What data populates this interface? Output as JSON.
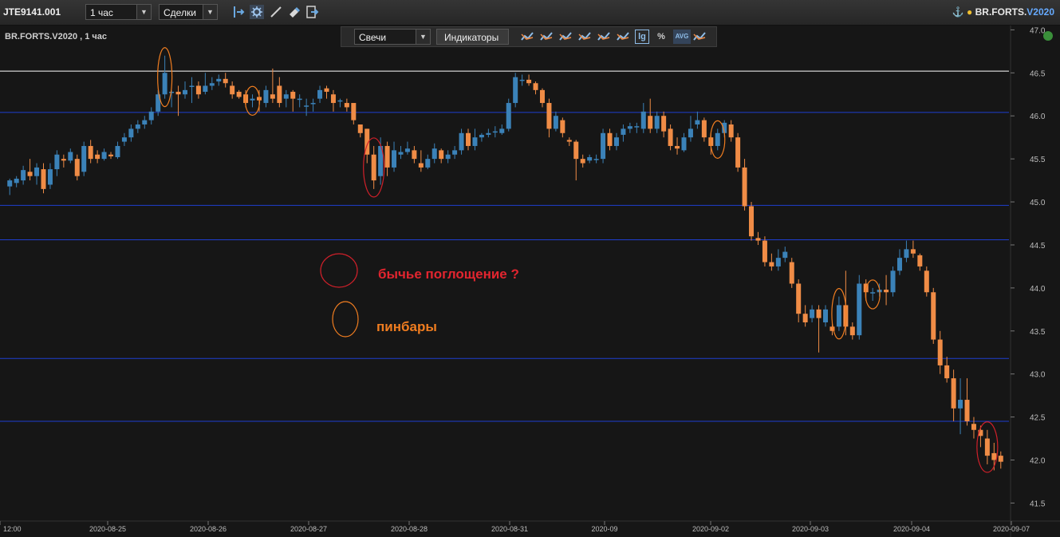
{
  "toolbar": {
    "account": "JTE9141.001",
    "interval": "1 час",
    "trades": "Сделки",
    "symbol": "BR.FORTS.",
    "symbol_version": "V2020",
    "icons": [
      "cursor-icon",
      "settings-icon",
      "draw-line-icon",
      "eraser-icon",
      "export-icon"
    ]
  },
  "chart": {
    "title": "BR.FORTS.V2020 , 1 час",
    "chart_type_select": "Свечи",
    "indicators_button": "Индикаторы",
    "percent_icon_label": "%",
    "lg_icon_label": "lg",
    "avg_icon_label": "AVG",
    "annotation_engulfing": "бычье поглощение ?",
    "annotation_pinbars": "пинбары",
    "colors": {
      "up": "#3b82b8",
      "down": "#f08c46",
      "level_line": "#1f3fd0",
      "white_line": "#ffffff",
      "engulf_mark": "#d0202a",
      "pinbar_mark": "#f07d20"
    }
  },
  "chart_data": {
    "type": "candlestick",
    "y_ticks": [
      "47.0",
      "46.5",
      "46.0",
      "45.5",
      "45.0",
      "44.5",
      "44.0",
      "43.5",
      "43.0",
      "42.5",
      "42.0",
      "41.5"
    ],
    "ylim": [
      41.3,
      47.05
    ],
    "x_ticks": [
      "12:00",
      "2020-08-25",
      "2020-08-26",
      "2020-08-27",
      "2020-08-28",
      "2020-08-31",
      "2020-09",
      "2020-09-02",
      "2020-09-03",
      "2020-09-04",
      "2020-09-07"
    ],
    "horizontal_levels": [
      46.52,
      46.04,
      44.96,
      44.56,
      43.18,
      42.45
    ],
    "candles": [
      [
        45.18,
        45.25,
        45.08,
        45.27
      ],
      [
        45.22,
        45.27,
        45.17,
        45.3
      ],
      [
        45.25,
        45.37,
        45.2,
        45.42
      ],
      [
        45.35,
        45.3,
        45.25,
        45.5
      ],
      [
        45.3,
        45.4,
        45.2,
        45.45
      ],
      [
        45.38,
        45.15,
        45.1,
        45.45
      ],
      [
        45.2,
        45.38,
        45.15,
        45.45
      ],
      [
        45.38,
        45.55,
        45.3,
        45.6
      ],
      [
        45.5,
        45.48,
        45.4,
        45.55
      ],
      [
        45.48,
        45.58,
        45.45,
        45.62
      ],
      [
        45.5,
        45.3,
        45.25,
        45.55
      ],
      [
        45.35,
        45.65,
        45.3,
        45.7
      ],
      [
        45.65,
        45.5,
        45.45,
        45.72
      ],
      [
        45.55,
        45.5,
        45.45,
        45.6
      ],
      [
        45.5,
        45.58,
        45.48,
        45.62
      ],
      [
        45.55,
        45.53,
        45.5,
        45.58
      ],
      [
        45.52,
        45.65,
        45.5,
        45.7
      ],
      [
        45.7,
        45.75,
        45.65,
        45.8
      ],
      [
        45.75,
        45.85,
        45.7,
        45.9
      ],
      [
        45.85,
        45.9,
        45.8,
        45.95
      ],
      [
        45.9,
        45.95,
        45.85,
        46.0
      ],
      [
        45.95,
        46.05,
        45.9,
        46.1
      ],
      [
        46.05,
        46.25,
        46.0,
        46.3
      ],
      [
        46.25,
        46.5,
        46.2,
        46.7
      ],
      [
        46.28,
        46.28,
        46.1,
        46.3
      ],
      [
        46.28,
        46.25,
        46.0,
        46.35
      ],
      [
        46.25,
        46.3,
        46.2,
        46.4
      ],
      [
        46.35,
        46.35,
        46.15,
        46.45
      ],
      [
        46.35,
        46.25,
        46.2,
        46.4
      ],
      [
        46.28,
        46.35,
        46.25,
        46.5
      ],
      [
        46.35,
        46.38,
        46.3,
        46.45
      ],
      [
        46.4,
        46.43,
        46.35,
        46.48
      ],
      [
        46.43,
        46.38,
        46.33,
        46.5
      ],
      [
        46.35,
        46.25,
        46.2,
        46.4
      ],
      [
        46.28,
        46.22,
        46.2,
        46.3
      ],
      [
        46.25,
        46.15,
        46.1,
        46.3
      ],
      [
        46.18,
        46.2,
        46.1,
        46.25
      ],
      [
        46.22,
        46.18,
        46.05,
        46.3
      ],
      [
        46.15,
        46.3,
        46.1,
        46.35
      ],
      [
        46.25,
        46.2,
        46.15,
        46.55
      ],
      [
        46.35,
        46.15,
        46.1,
        46.45
      ],
      [
        46.2,
        46.25,
        46.1,
        46.3
      ],
      [
        46.28,
        46.2,
        46.05,
        46.3
      ],
      [
        46.2,
        46.2,
        46.1,
        46.25
      ],
      [
        46.12,
        46.12,
        46.0,
        46.2
      ],
      [
        46.15,
        46.15,
        46.05,
        46.2
      ],
      [
        46.2,
        46.3,
        46.15,
        46.35
      ],
      [
        46.32,
        46.28,
        46.2,
        46.35
      ],
      [
        46.25,
        46.15,
        46.05,
        46.3
      ],
      [
        46.18,
        46.18,
        46.1,
        46.2
      ],
      [
        46.15,
        46.1,
        46.05,
        46.2
      ],
      [
        46.15,
        45.95,
        45.9,
        46.1
      ],
      [
        45.9,
        45.8,
        45.75,
        45.9
      ],
      [
        45.85,
        45.55,
        45.45,
        45.85
      ],
      [
        45.55,
        45.25,
        45.15,
        45.65
      ],
      [
        45.3,
        45.65,
        45.2,
        45.75
      ],
      [
        45.65,
        45.4,
        45.3,
        45.7
      ],
      [
        45.4,
        45.6,
        45.35,
        45.7
      ],
      [
        45.55,
        45.58,
        45.5,
        45.65
      ],
      [
        45.58,
        45.62,
        45.55,
        45.7
      ],
      [
        45.6,
        45.5,
        45.45,
        45.65
      ],
      [
        45.45,
        45.4,
        45.35,
        45.6
      ],
      [
        45.4,
        45.5,
        45.38,
        45.55
      ],
      [
        45.5,
        45.62,
        45.45,
        45.68
      ],
      [
        45.6,
        45.5,
        45.45,
        45.62
      ],
      [
        45.5,
        45.55,
        45.45,
        45.6
      ],
      [
        45.55,
        45.6,
        45.5,
        45.65
      ],
      [
        45.6,
        45.8,
        45.55,
        45.85
      ],
      [
        45.8,
        45.65,
        45.6,
        45.85
      ],
      [
        45.65,
        45.75,
        45.6,
        45.85
      ],
      [
        45.75,
        45.78,
        45.7,
        45.8
      ],
      [
        45.78,
        45.8,
        45.75,
        45.85
      ],
      [
        45.82,
        45.82,
        45.75,
        45.88
      ],
      [
        45.8,
        45.85,
        45.78,
        45.9
      ],
      [
        45.85,
        46.15,
        45.82,
        46.2
      ],
      [
        46.15,
        46.45,
        46.1,
        46.5
      ],
      [
        46.42,
        46.42,
        46.35,
        46.48
      ],
      [
        46.42,
        46.38,
        46.35,
        46.48
      ],
      [
        46.38,
        46.3,
        46.25,
        46.4
      ],
      [
        46.3,
        46.15,
        46.1,
        46.32
      ],
      [
        46.15,
        45.85,
        45.75,
        46.2
      ],
      [
        45.85,
        46.0,
        45.82,
        46.05
      ],
      [
        45.95,
        45.8,
        45.75,
        45.98
      ],
      [
        45.72,
        45.7,
        45.65,
        45.75
      ],
      [
        45.7,
        45.5,
        45.25,
        45.72
      ],
      [
        45.5,
        45.45,
        45.4,
        45.55
      ],
      [
        45.48,
        45.52,
        45.45,
        45.55
      ],
      [
        45.5,
        45.5,
        45.45,
        45.55
      ],
      [
        45.5,
        45.8,
        45.45,
        45.85
      ],
      [
        45.8,
        45.65,
        45.6,
        45.85
      ],
      [
        45.65,
        45.75,
        45.6,
        45.8
      ],
      [
        45.78,
        45.85,
        45.7,
        45.9
      ],
      [
        45.85,
        45.88,
        45.8,
        45.92
      ],
      [
        45.88,
        45.88,
        45.8,
        45.92
      ],
      [
        45.85,
        46.05,
        45.8,
        46.15
      ],
      [
        46.0,
        45.85,
        45.8,
        46.2
      ],
      [
        45.85,
        46.0,
        45.8,
        46.05
      ],
      [
        46.0,
        45.82,
        45.75,
        46.05
      ],
      [
        45.85,
        45.65,
        45.6,
        45.9
      ],
      [
        45.65,
        45.62,
        45.55,
        45.75
      ],
      [
        45.6,
        45.75,
        45.58,
        45.8
      ],
      [
        45.75,
        45.85,
        45.7,
        46.0
      ],
      [
        45.9,
        45.95,
        45.85,
        46.05
      ],
      [
        45.95,
        45.75,
        45.7,
        45.98
      ],
      [
        45.75,
        45.65,
        45.55,
        45.8
      ],
      [
        45.65,
        45.8,
        45.6,
        45.85
      ],
      [
        45.8,
        45.92,
        45.75,
        45.95
      ],
      [
        45.9,
        45.75,
        45.7,
        45.95
      ],
      [
        45.75,
        45.4,
        45.35,
        45.8
      ],
      [
        45.4,
        44.95,
        44.9,
        45.5
      ],
      [
        44.95,
        44.6,
        44.55,
        45.0
      ],
      [
        44.58,
        44.55,
        44.5,
        44.65
      ],
      [
        44.55,
        44.3,
        44.25,
        44.6
      ],
      [
        44.3,
        44.25,
        44.2,
        44.4
      ],
      [
        44.25,
        44.35,
        44.2,
        44.45
      ],
      [
        44.35,
        44.42,
        44.3,
        44.48
      ],
      [
        44.3,
        44.05,
        44.0,
        44.35
      ],
      [
        44.05,
        43.7,
        43.6,
        44.1
      ],
      [
        43.7,
        43.6,
        43.55,
        43.8
      ],
      [
        43.65,
        43.75,
        43.6,
        43.8
      ],
      [
        43.75,
        43.65,
        43.25,
        43.8
      ],
      [
        43.6,
        43.75,
        43.55,
        43.8
      ],
      [
        43.55,
        43.5,
        43.45,
        43.6
      ],
      [
        43.55,
        43.8,
        43.5,
        43.9
      ],
      [
        43.8,
        43.55,
        43.45,
        44.2
      ],
      [
        43.55,
        43.45,
        43.4,
        43.6
      ],
      [
        43.45,
        44.05,
        43.4,
        44.15
      ],
      [
        44.05,
        43.95,
        43.85,
        44.1
      ],
      [
        43.95,
        43.95,
        43.85,
        44.0
      ],
      [
        43.95,
        43.98,
        43.9,
        44.05
      ],
      [
        43.98,
        43.95,
        43.8,
        44.15
      ],
      [
        43.95,
        44.2,
        43.9,
        44.25
      ],
      [
        44.2,
        44.35,
        44.15,
        44.45
      ],
      [
        44.35,
        44.45,
        44.3,
        44.55
      ],
      [
        44.45,
        44.4,
        44.35,
        44.55
      ],
      [
        44.38,
        44.25,
        44.2,
        44.4
      ],
      [
        44.2,
        43.95,
        43.9,
        44.25
      ],
      [
        43.95,
        43.4,
        43.35,
        44.0
      ],
      [
        43.4,
        43.1,
        43.0,
        43.5
      ],
      [
        43.1,
        42.95,
        42.9,
        43.2
      ],
      [
        42.95,
        42.6,
        42.45,
        43.05
      ],
      [
        42.6,
        42.7,
        42.3,
        42.95
      ],
      [
        42.7,
        42.45,
        42.4,
        42.95
      ],
      [
        42.42,
        42.35,
        42.25,
        42.5
      ],
      [
        42.35,
        42.28,
        42.15,
        42.4
      ],
      [
        42.25,
        42.05,
        41.95,
        42.35
      ],
      [
        42.08,
        42.0,
        41.88,
        42.2
      ],
      [
        42.05,
        41.98,
        41.9,
        42.1
      ]
    ],
    "annotations": [
      {
        "kind": "pinbar",
        "candle": 23
      },
      {
        "kind": "pinbar",
        "candle": 36
      },
      {
        "kind": "engulfing",
        "candle": 54
      },
      {
        "kind": "pinbar",
        "candle": 105
      },
      {
        "kind": "pinbar",
        "candle": 123
      },
      {
        "kind": "pinbar",
        "candle": 128
      },
      {
        "kind": "engulfing",
        "candle": 145
      }
    ]
  }
}
